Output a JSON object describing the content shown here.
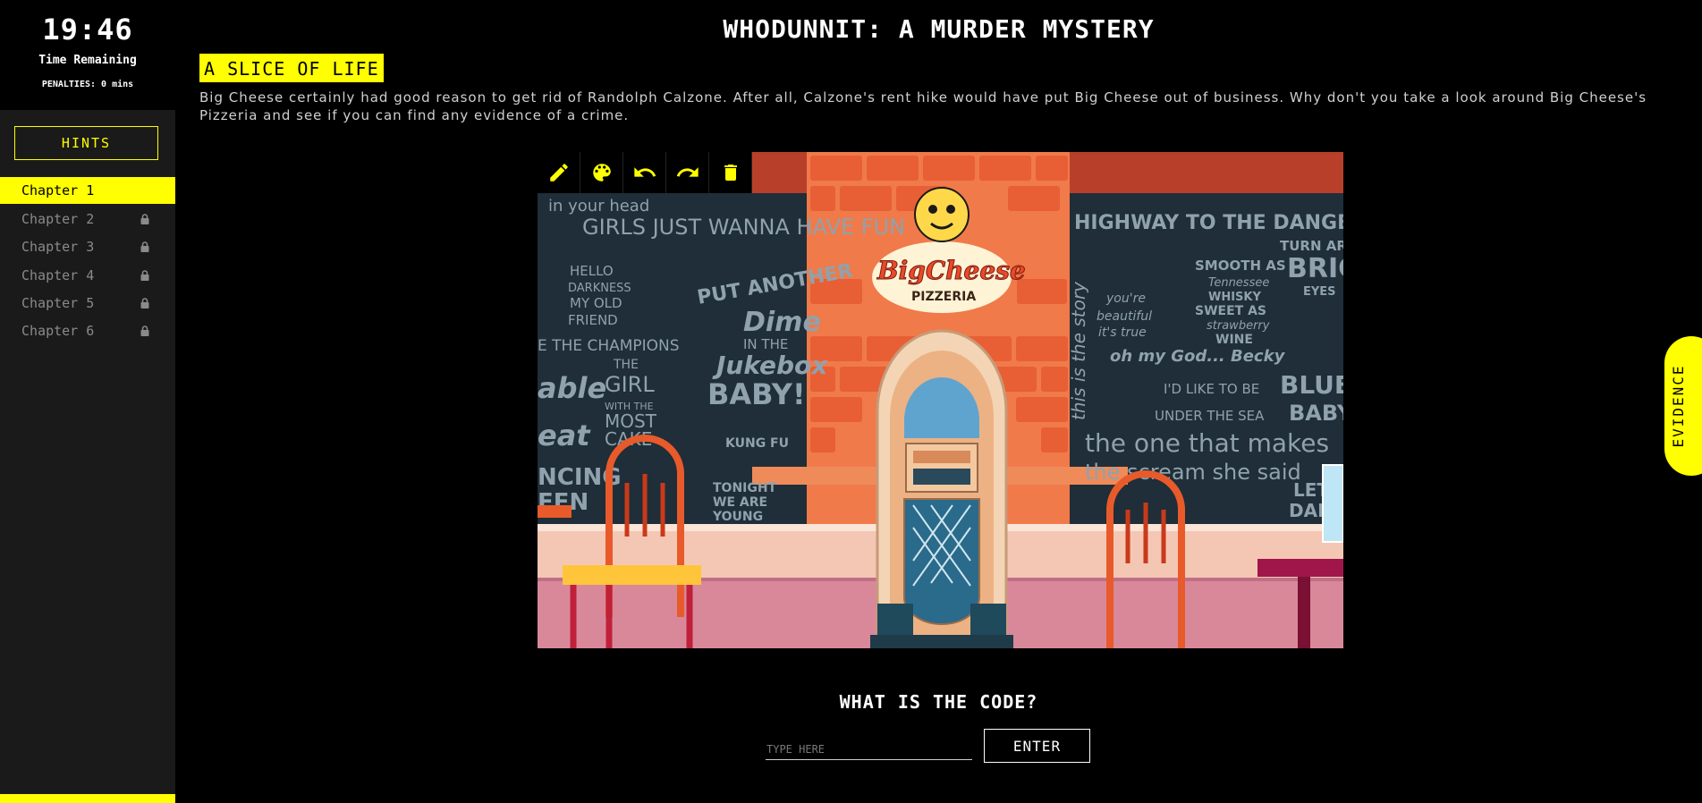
{
  "timer": {
    "value": "19:46",
    "label": "Time Remaining",
    "penalties": "PENALTIES: 0 mins"
  },
  "sidebar": {
    "hints_label": "HINTS",
    "chapters": [
      {
        "label": "Chapter 1",
        "locked": false,
        "active": true
      },
      {
        "label": "Chapter 2",
        "locked": true,
        "active": false
      },
      {
        "label": "Chapter 3",
        "locked": true,
        "active": false
      },
      {
        "label": "Chapter 4",
        "locked": true,
        "active": false
      },
      {
        "label": "Chapter 5",
        "locked": true,
        "active": false
      },
      {
        "label": "Chapter 6",
        "locked": true,
        "active": false
      }
    ]
  },
  "main": {
    "title": "WHODUNNIT: A MURDER MYSTERY",
    "chapter_title": "A SLICE OF LIFE",
    "intro": "Big Cheese certainly had good reason to get rid of Randolph Calzone. After all, Calzone's rent hike would have put Big Cheese out of business. Why don't you take a look around Big Cheese's Pizzeria and see if you can find any evidence of a crime."
  },
  "toolbar": {
    "tools": [
      "pencil-icon",
      "palette-icon",
      "undo-icon",
      "redo-icon",
      "trash-icon"
    ]
  },
  "scene": {
    "logo_top": "BigCheese",
    "logo_bottom": "PIZZERIA",
    "wall_left": [
      "in your head",
      "GIRLS JUST WANNA HAVE FUN",
      "HELLO",
      "DARKNESS",
      "MY OLD",
      "FRIEND",
      "PUT ANOTHER",
      "Dime",
      "IN THE",
      "Jukebox",
      "BABY!",
      "E THE CHAMPIONS",
      "THE",
      "GIRL",
      "WITH THE",
      "MOST",
      "CAKE",
      "able",
      "eat",
      "NCING",
      "EEN",
      "TONIGHT",
      "WE ARE",
      "YOUNG",
      "KUNG FU"
    ],
    "wall_right": [
      "HIGHWAY TO THE DANGER ZONE",
      "SMOOTH AS",
      "Tennessee",
      "WHISKY",
      "SWEET AS",
      "strawberry",
      "WINE",
      "TURN AROUND",
      "BRIGHT",
      "EYES",
      "you're",
      "beautiful",
      "it's true",
      "oh my God... Becky",
      "I'D LIKE TO BE",
      "UNDER THE SEA",
      "BLUE",
      "BABY",
      "the one that makes",
      "the scream she said",
      "LET'S",
      "DANCE",
      "this is the story"
    ]
  },
  "code": {
    "label": "WHAT IS THE CODE?",
    "placeholder": "TYPE HERE",
    "enter_label": "ENTER"
  },
  "evidence": {
    "label": "EVIDENCE"
  },
  "colors": {
    "accent": "#ffff00",
    "sidebar_bg": "#1a1a1a",
    "page_bg": "#000000",
    "brick": "#f26f3f",
    "chalkboard": "#1f2e38"
  }
}
